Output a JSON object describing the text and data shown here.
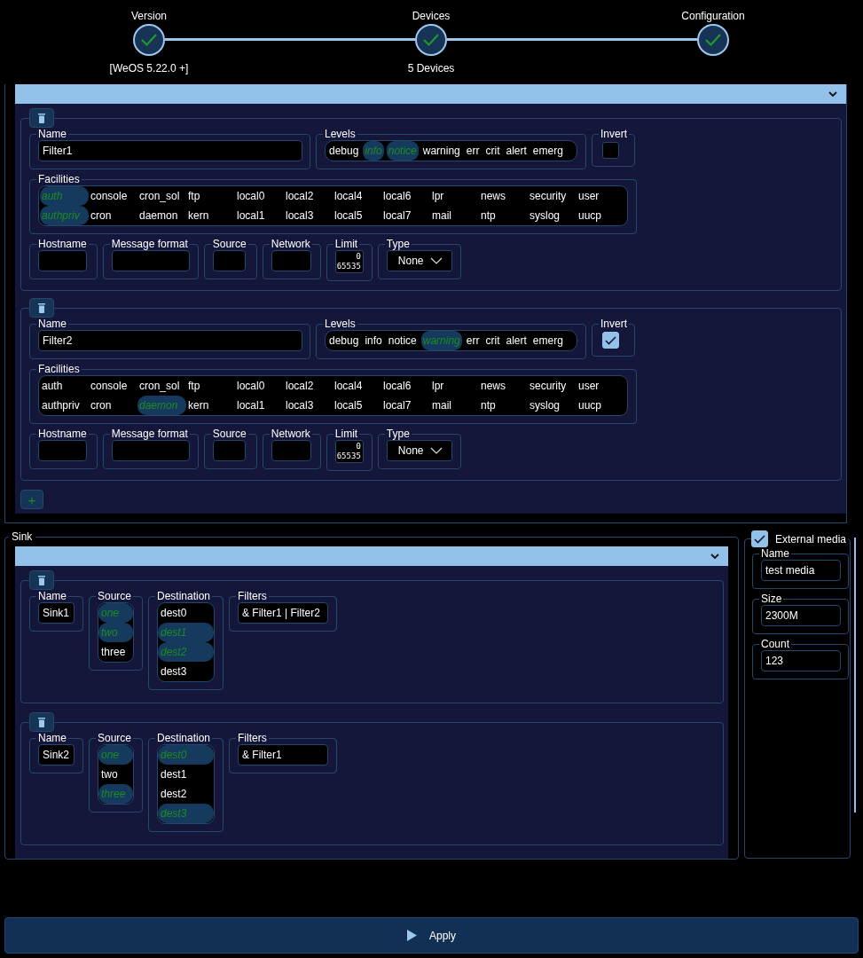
{
  "steps": [
    {
      "label": "Version",
      "sublabel": "[WeOS 5.22.0 +]",
      "done": true
    },
    {
      "label": "Devices",
      "sublabel": "5 Devices",
      "done": true
    },
    {
      "label": "Configuration",
      "done": true
    }
  ],
  "filters": [
    {
      "name_label": "Name",
      "name": "Filter1",
      "levels_label": "Levels",
      "levels": [
        {
          "label": "debug",
          "selected": false
        },
        {
          "label": "info",
          "selected": true
        },
        {
          "label": "notice",
          "selected": true
        },
        {
          "label": "warning",
          "selected": false
        },
        {
          "label": "err",
          "selected": false
        },
        {
          "label": "crit",
          "selected": false
        },
        {
          "label": "alert",
          "selected": false
        },
        {
          "label": "emerg",
          "selected": false
        }
      ],
      "invert_label": "Invert",
      "invert": false,
      "facilities_label": "Facilities",
      "facilities": [
        {
          "label": "auth",
          "selected": true
        },
        {
          "label": "authpriv",
          "selected": true
        },
        {
          "label": "console",
          "selected": false
        },
        {
          "label": "cron",
          "selected": false
        },
        {
          "label": "cron_sol",
          "selected": false
        },
        {
          "label": "daemon",
          "selected": false
        },
        {
          "label": "ftp",
          "selected": false
        },
        {
          "label": "kern",
          "selected": false
        },
        {
          "label": "local0",
          "selected": false
        },
        {
          "label": "local1",
          "selected": false
        },
        {
          "label": "local2",
          "selected": false
        },
        {
          "label": "local3",
          "selected": false
        },
        {
          "label": "local4",
          "selected": false
        },
        {
          "label": "local5",
          "selected": false
        },
        {
          "label": "local6",
          "selected": false
        },
        {
          "label": "local7",
          "selected": false
        },
        {
          "label": "lpr",
          "selected": false
        },
        {
          "label": "mail",
          "selected": false
        },
        {
          "label": "news",
          "selected": false
        },
        {
          "label": "ntp",
          "selected": false
        },
        {
          "label": "security",
          "selected": false
        },
        {
          "label": "syslog",
          "selected": false
        },
        {
          "label": "user",
          "selected": false
        },
        {
          "label": "uucp",
          "selected": false
        }
      ],
      "fields": [
        {
          "label": "Hostname"
        },
        {
          "label": "Message format"
        },
        {
          "label": "Source"
        },
        {
          "label": "Network"
        }
      ],
      "limit": {
        "label": "Limit",
        "upper": "0",
        "lower": "65535"
      },
      "type": {
        "label": "Type",
        "value": "None"
      }
    },
    {
      "name_label": "Name",
      "name": "Filter2",
      "levels_label": "Levels",
      "levels": [
        {
          "label": "debug",
          "selected": false
        },
        {
          "label": "info",
          "selected": false
        },
        {
          "label": "notice",
          "selected": false
        },
        {
          "label": "warning",
          "selected": true
        },
        {
          "label": "err",
          "selected": false
        },
        {
          "label": "crit",
          "selected": false
        },
        {
          "label": "alert",
          "selected": false
        },
        {
          "label": "emerg",
          "selected": false
        }
      ],
      "invert_label": "Invert",
      "invert": true,
      "facilities_label": "Facilities",
      "facilities": [
        {
          "label": "auth",
          "selected": false
        },
        {
          "label": "authpriv",
          "selected": false
        },
        {
          "label": "console",
          "selected": false
        },
        {
          "label": "cron",
          "selected": false
        },
        {
          "label": "cron_sol",
          "selected": false
        },
        {
          "label": "daemon",
          "selected": true
        },
        {
          "label": "ftp",
          "selected": false
        },
        {
          "label": "kern",
          "selected": false
        },
        {
          "label": "local0",
          "selected": false
        },
        {
          "label": "local1",
          "selected": false
        },
        {
          "label": "local2",
          "selected": false
        },
        {
          "label": "local3",
          "selected": false
        },
        {
          "label": "local4",
          "selected": false
        },
        {
          "label": "local5",
          "selected": false
        },
        {
          "label": "local6",
          "selected": false
        },
        {
          "label": "local7",
          "selected": false
        },
        {
          "label": "lpr",
          "selected": false
        },
        {
          "label": "mail",
          "selected": false
        },
        {
          "label": "news",
          "selected": false
        },
        {
          "label": "ntp",
          "selected": false
        },
        {
          "label": "security",
          "selected": false
        },
        {
          "label": "syslog",
          "selected": false
        },
        {
          "label": "user",
          "selected": false
        },
        {
          "label": "uucp",
          "selected": false
        }
      ],
      "fields": [
        {
          "label": "Hostname"
        },
        {
          "label": "Message format"
        },
        {
          "label": "Source"
        },
        {
          "label": "Network"
        }
      ],
      "limit": {
        "label": "Limit",
        "upper": "0",
        "lower": "65535"
      },
      "type": {
        "label": "Type",
        "value": "None"
      }
    }
  ],
  "add_button": "+",
  "sink": {
    "title": "Sink",
    "sinks": [
      {
        "name_label": "Name",
        "name": "Sink1",
        "source_label": "Source",
        "sources": [
          {
            "label": "one",
            "selected": true
          },
          {
            "label": "two",
            "selected": true
          },
          {
            "label": "three",
            "selected": false
          }
        ],
        "destination_label": "Destination",
        "destinations": [
          {
            "label": "dest0",
            "selected": false
          },
          {
            "label": "dest1",
            "selected": true
          },
          {
            "label": "dest2",
            "selected": true
          },
          {
            "label": "dest3",
            "selected": false
          }
        ],
        "filters_label": "Filters",
        "filters": "& Filter1 | Filter2"
      },
      {
        "name_label": "Name",
        "name": "Sink2",
        "source_label": "Source",
        "sources": [
          {
            "label": "one",
            "selected": true
          },
          {
            "label": "two",
            "selected": false
          },
          {
            "label": "three",
            "selected": true
          }
        ],
        "destination_label": "Destination",
        "destinations": [
          {
            "label": "dest0",
            "selected": true
          },
          {
            "label": "dest1",
            "selected": false
          },
          {
            "label": "dest2",
            "selected": false
          },
          {
            "label": "dest3",
            "selected": true
          }
        ],
        "filters_label": "Filters",
        "filters": "& Filter1"
      }
    ]
  },
  "external_media": {
    "label": "External media",
    "checked": true,
    "fields": [
      {
        "label": "Name",
        "value": "test media"
      },
      {
        "label": "Size",
        "value": "2300M"
      },
      {
        "label": "Count",
        "value": "123"
      }
    ]
  },
  "apply_button": "Apply"
}
